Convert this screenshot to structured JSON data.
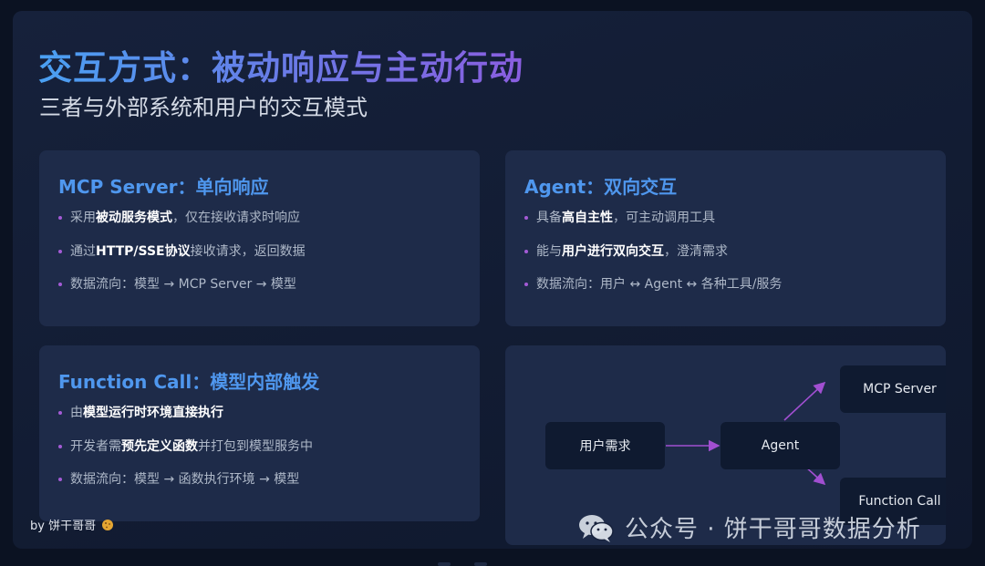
{
  "slide": {
    "title": "交互方式：被动响应与主动行动",
    "subtitle": "三者与外部系统和用户的交互模式"
  },
  "cards": [
    {
      "title": "MCP Server：单向响应",
      "bullets": [
        {
          "pre": "采用",
          "bold": "被动服务模式",
          "post": "，仅在接收请求时响应"
        },
        {
          "pre": "通过",
          "bold": "HTTP/SSE协议",
          "post": "接收请求，返回数据"
        },
        {
          "pre": "数据流向：模型 → MCP Server → 模型",
          "bold": "",
          "post": ""
        }
      ]
    },
    {
      "title": "Agent：双向交互",
      "bullets": [
        {
          "pre": "具备",
          "bold": "高自主性",
          "post": "，可主动调用工具"
        },
        {
          "pre": "能与",
          "bold": "用户进行双向交互",
          "post": "，澄清需求"
        },
        {
          "pre": "数据流向：用户 ↔ Agent ↔ 各种工具/服务",
          "bold": "",
          "post": ""
        }
      ]
    },
    {
      "title": "Function Call：模型内部触发",
      "bullets": [
        {
          "pre": "由",
          "bold": "模型运行时环境直接执行",
          "post": ""
        },
        {
          "pre": "开发者需",
          "bold": "预先定义函数",
          "post": "并打包到模型服务中"
        },
        {
          "pre": "数据流向：模型 → 函数执行环境 → 模型",
          "bold": "",
          "post": ""
        }
      ]
    }
  ],
  "diagram": {
    "nodes": {
      "user_request": "用户需求",
      "agent": "Agent",
      "mcp_server": "MCP Server",
      "function_call": "Function Call"
    },
    "arrow_color": "#a14fd1"
  },
  "footer": {
    "byline": "by 饼干哥哥",
    "watermark": "公众号 · 饼干哥哥数据分析"
  },
  "colors": {
    "title_gradient_start": "#4aa0f2",
    "title_gradient_end": "#8a5ee0",
    "card_title": "#4f97ee",
    "bullet_dot": "#a45bd6",
    "card_bg": "#1e2b49"
  }
}
